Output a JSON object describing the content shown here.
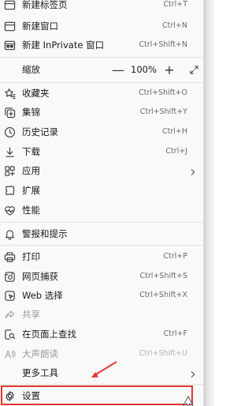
{
  "menu": {
    "items": [
      {
        "label": "新建标签页",
        "shortcut": "Ctrl+T",
        "icon": "new-tab-icon"
      },
      {
        "label": "新建窗口",
        "shortcut": "Ctrl+N",
        "icon": "new-window-icon"
      },
      {
        "label": "新建 InPrivate 窗口",
        "shortcut": "Ctrl+Shift+N",
        "icon": "inprivate-window-icon"
      },
      {
        "label": "收藏夹",
        "shortcut": "Ctrl+Shift+O",
        "icon": "favorites-icon"
      },
      {
        "label": "集锦",
        "shortcut": "Ctrl+Shift+Y",
        "icon": "collections-icon"
      },
      {
        "label": "历史记录",
        "shortcut": "Ctrl+H",
        "icon": "history-icon"
      },
      {
        "label": "下载",
        "shortcut": "Ctrl+J",
        "icon": "download-icon"
      },
      {
        "label": "应用",
        "shortcut": "",
        "icon": "apps-icon"
      },
      {
        "label": "扩展",
        "shortcut": "",
        "icon": "extensions-icon"
      },
      {
        "label": "性能",
        "shortcut": "",
        "icon": "performance-icon"
      },
      {
        "label": "警报和提示",
        "shortcut": "",
        "icon": "bell-icon"
      },
      {
        "label": "打印",
        "shortcut": "Ctrl+P",
        "icon": "print-icon"
      },
      {
        "label": "网页捕获",
        "shortcut": "Ctrl+Shift+S",
        "icon": "web-capture-icon"
      },
      {
        "label": "Web 选择",
        "shortcut": "Ctrl+Shift+X",
        "icon": "web-select-icon"
      },
      {
        "label": "共享",
        "shortcut": "",
        "icon": "share-icon"
      },
      {
        "label": "在页面上查找",
        "shortcut": "Ctrl+F",
        "icon": "find-icon"
      },
      {
        "label": "大声朗读",
        "shortcut": "Ctrl+Shift+U",
        "icon": "read-aloud-icon"
      },
      {
        "label": "更多工具",
        "shortcut": "",
        "icon": ""
      },
      {
        "label": "设置",
        "shortcut": "",
        "icon": "gear-icon"
      }
    ],
    "zoom": {
      "label": "缩放",
      "minus": "—",
      "value": "100%",
      "plus": "+",
      "fullscreen_icon": "fullscreen-icon"
    }
  },
  "annotation": {
    "highlight_color": "#e0362c"
  }
}
